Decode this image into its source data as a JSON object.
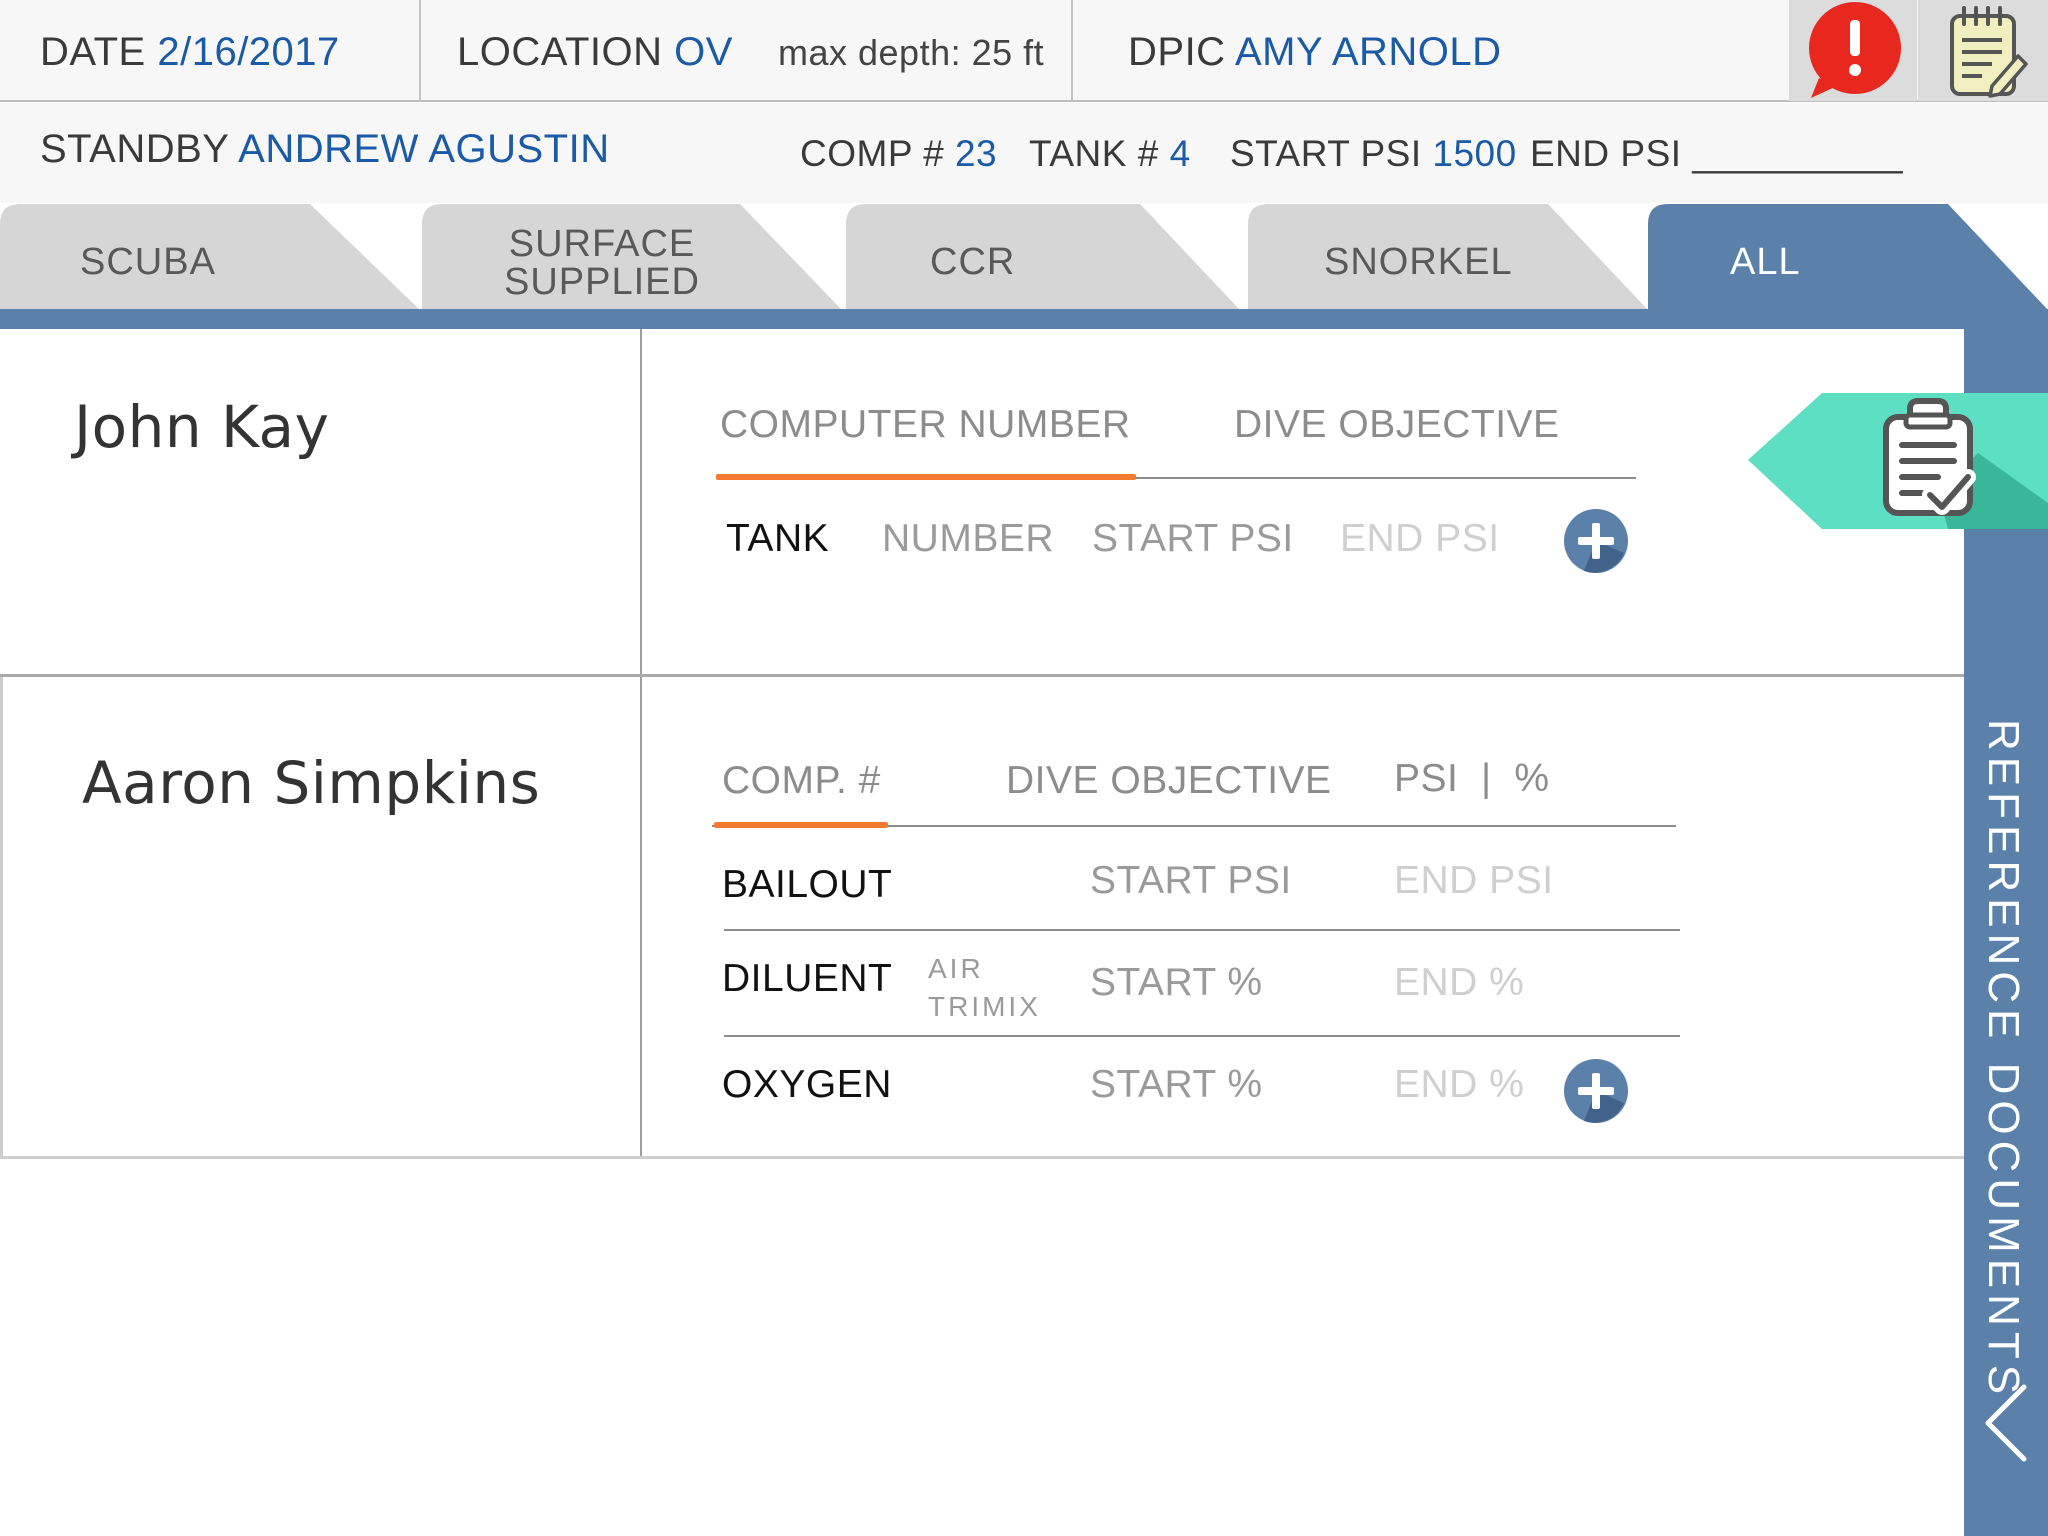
{
  "header": {
    "date_label": "DATE",
    "date_value": "2/16/2017",
    "location_label": "LOCATION",
    "location_value": "OV",
    "max_depth": "max depth: 25 ft",
    "dpic_label": "DPIC",
    "dpic_value": "AMY ARNOLD",
    "alert_icon": "alert-icon",
    "notes_icon": "notepad-icon"
  },
  "info": {
    "standby_label": "STANDBY",
    "standby_value": "ANDREW AGUSTIN",
    "comp_label": "COMP #",
    "comp_value": "23",
    "tank_label": "TANK #",
    "tank_value": "4",
    "start_psi_label": "START PSI",
    "start_psi_value": "1500",
    "end_psi_label": "END PSI",
    "end_psi_value": "__________"
  },
  "tabs": [
    {
      "label": "SCUBA",
      "active": false
    },
    {
      "label_line1": "SURFACE",
      "label_line2": "SUPPLIED",
      "active": false
    },
    {
      "label": "CCR",
      "active": false
    },
    {
      "label": "SNORKEL",
      "active": false
    },
    {
      "label": "ALL",
      "active": true
    }
  ],
  "divers": [
    {
      "name": "John Kay",
      "tabs": [
        "COMPUTER NUMBER",
        "DIVE OBJECTIVE"
      ],
      "row": {
        "label": "TANK",
        "number": "NUMBER",
        "start": "START PSI",
        "end": "END PSI"
      }
    },
    {
      "name": "Aaron Simpkins",
      "tabs": [
        "COMP. #",
        "DIVE OBJECTIVE",
        "PSI  |  %"
      ],
      "rows": [
        {
          "label": "BAILOUT",
          "start": "START PSI",
          "end": "END PSI"
        },
        {
          "label": "DILUENT",
          "gas1": "AIR",
          "gas2": "TRIMIX",
          "start": "START %",
          "end": "END %"
        },
        {
          "label": "OXYGEN",
          "start": "START %",
          "end": "END %"
        }
      ]
    }
  ],
  "reference_panel": {
    "label": "REFERENCE DOCUMENTS",
    "checklist_icon": "clipboard-check-icon"
  },
  "colors": {
    "accent_blue": "#5b80aa",
    "value_blue": "#1a5aa6",
    "orange": "#f47a2f",
    "teal": "#5ddfc4",
    "alert_red": "#e8281e"
  }
}
